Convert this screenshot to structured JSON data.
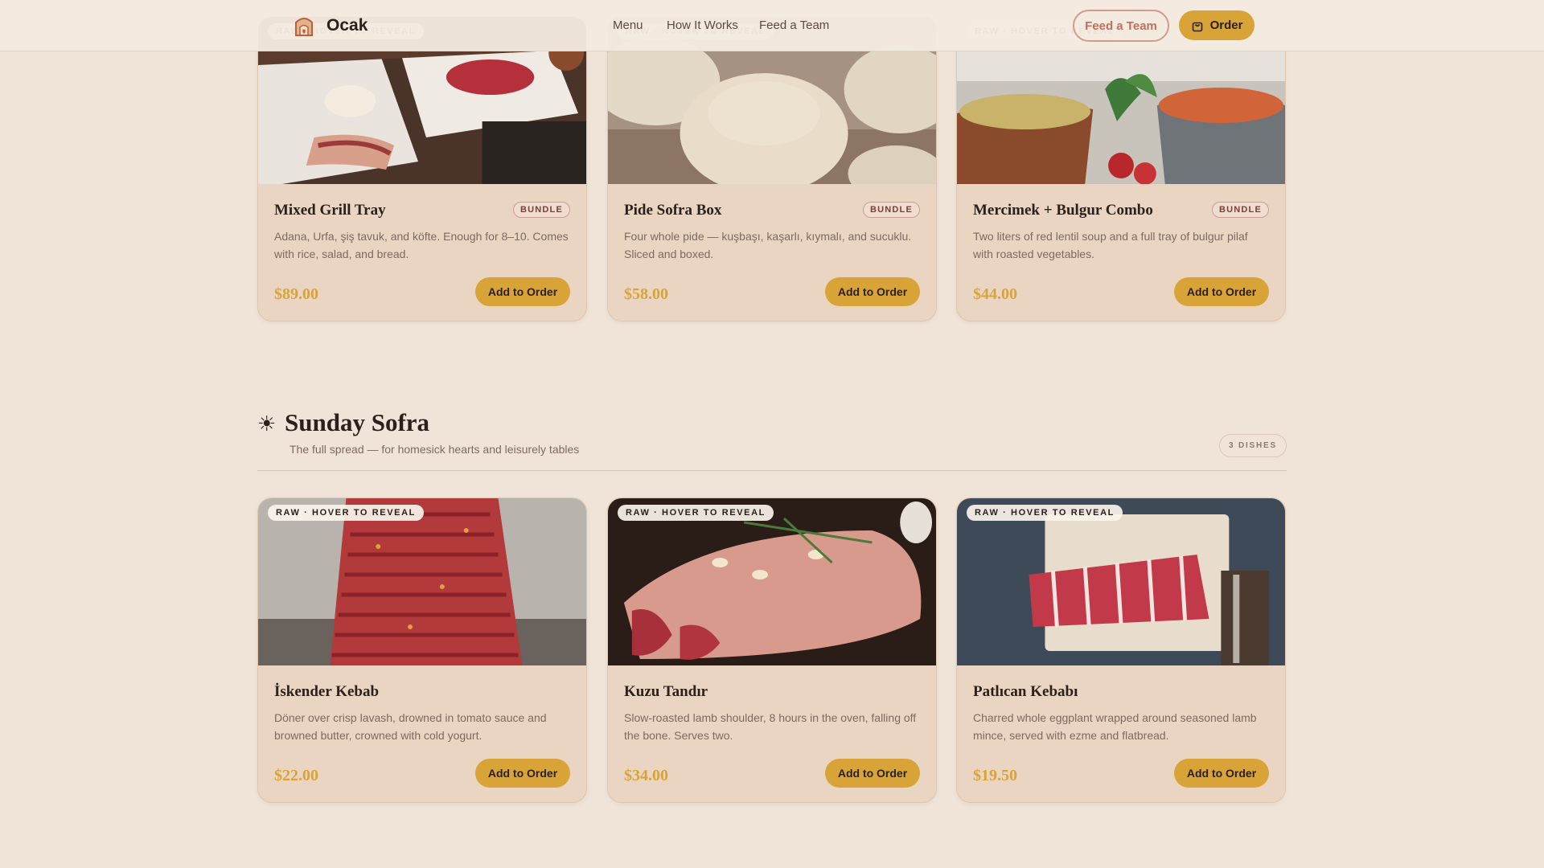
{
  "header": {
    "brand": "Ocak",
    "nav": [
      "Menu",
      "How It Works",
      "Feed a Team"
    ],
    "feed_team_button": "Feed a Team",
    "order_button": "Order"
  },
  "raw_label": "RAW · HOVER TO REVEAL",
  "bundles": [
    {
      "title": "Mixed Grill Tray",
      "badge": "BUNDLE",
      "description": "Adana, Urfa, şiş tavuk, and köfte. Enough for 8–10. Comes with rice, salad, and bread.",
      "price": "$89.00",
      "button": "Add to Order"
    },
    {
      "title": "Pide Sofra Box",
      "badge": "BUNDLE",
      "description": "Four whole pide — kuşbaşı, kaşarlı, kıymalı, and sucuklu. Sliced and boxed.",
      "price": "$58.00",
      "button": "Add to Order"
    },
    {
      "title": "Mercimek + Bulgur Combo",
      "badge": "BUNDLE",
      "description": "Two liters of red lentil soup and a full tray of bulgur pilaf with roasted vegetables.",
      "price": "$44.00",
      "button": "Add to Order"
    }
  ],
  "section": {
    "icon": "☀",
    "title": "Sunday Sofra",
    "subtitle": "The full spread — for homesick hearts and leisurely tables",
    "count": "3 DISHES"
  },
  "dishes": [
    {
      "title": "İskender Kebab",
      "description": "Döner over crisp lavash, drowned in tomato sauce and browned butter, crowned with cold yogurt.",
      "price": "$22.00",
      "button": "Add to Order"
    },
    {
      "title": "Kuzu Tandır",
      "description": "Slow-roasted lamb shoulder, 8 hours in the oven, falling off the bone. Serves two.",
      "price": "$34.00",
      "button": "Add to Order"
    },
    {
      "title": "Patlıcan Kebabı",
      "description": "Charred whole eggplant wrapped around seasoned lamb mince, served with ezme and flatbread.",
      "price": "$19.50",
      "button": "Add to Order"
    }
  ],
  "colors": {
    "page_bg": "#f0e4d8",
    "card_bg": "#ead5c3",
    "accent_gold": "#d9a437",
    "outline_red": "#c0705f"
  }
}
